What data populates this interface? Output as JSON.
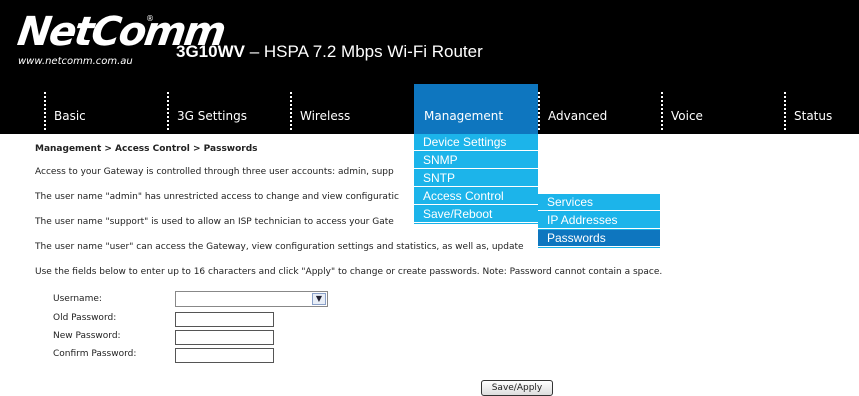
{
  "brand": {
    "logo_text": "NetComm",
    "reg_mark": "®",
    "url": "www.netcomm.com.au",
    "product_model": "3G10WV",
    "product_desc": " – HSPA 7.2 Mbps Wi-Fi Router"
  },
  "nav": {
    "items": [
      {
        "label": "Basic"
      },
      {
        "label": "3G Settings"
      },
      {
        "label": "Wireless"
      },
      {
        "label": "Management"
      },
      {
        "label": "Advanced"
      },
      {
        "label": "Voice"
      },
      {
        "label": "Status"
      }
    ]
  },
  "management_menu": [
    {
      "label": "Device Settings"
    },
    {
      "label": "SNMP"
    },
    {
      "label": "SNTP"
    },
    {
      "label": "Access Control"
    },
    {
      "label": "Save/Reboot"
    }
  ],
  "access_control_submenu": [
    {
      "label": "Services"
    },
    {
      "label": "IP Addresses"
    },
    {
      "label": "Passwords"
    }
  ],
  "page": {
    "breadcrumb": "Management > Access Control > Passwords",
    "paragraphs": [
      "Access to your Gateway is controlled through three user accounts: admin, supp",
      "The user name \"admin\" has unrestricted access to change and view configuratic",
      "The user name \"support\" is used to allow an ISP technician to access your Gate",
      "The user name \"user\" can access the Gateway, view configuration settings and statistics, as well as, update",
      "Use the fields below to enter up to 16 characters and click \"Apply\" to change or create passwords. Note: Password cannot contain a space."
    ]
  },
  "form": {
    "username_label": "Username:",
    "old_password_label": "Old Password:",
    "new_password_label": "New Password:",
    "confirm_password_label": "Confirm Password:",
    "username_value": "",
    "apply_label": "Save/Apply"
  },
  "colors": {
    "header_bg": "#000000",
    "menu_bg": "#1cb4ea",
    "menu_selected": "#0e76bf"
  }
}
